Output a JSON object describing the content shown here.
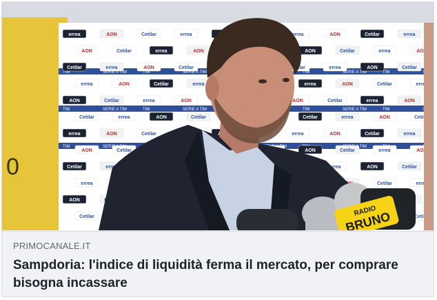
{
  "link_preview": {
    "image": {
      "description_icon": "press-interview-photo",
      "colors": {
        "board": "#ffffff",
        "board_stripe": "#2f4f9a",
        "stripe_text": "#ffffff",
        "jacket": "#1f2430",
        "shirt": "#c7d3e5",
        "skin": "#c98e78",
        "hair": "#3a2a20",
        "left_panel": "#e7c53a",
        "mic_yellow": "#f6d316"
      },
      "sponsor_labels": [
        "errea",
        "AON",
        "Cetilar",
        "TIM",
        "SERIE A TIM"
      ],
      "mic_label": "RADIO BRUNO"
    },
    "domain": "PRIMOCANALE.IT",
    "title": "Sampdoria: l'indice di liquidità ferma il mercato, per comprare bisogna incassare"
  }
}
